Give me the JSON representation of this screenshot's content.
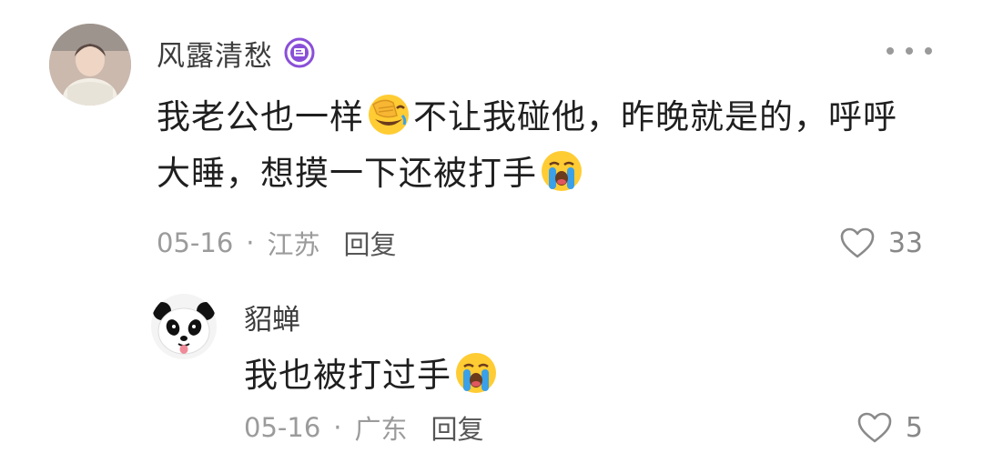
{
  "main_comment": {
    "username": "风露清愁",
    "text_parts": [
      "我老公也一样",
      "不让我碰他，昨晚就是的，呼呼大睡，想摸一下还被打手"
    ],
    "emojis": [
      "face-palm-laugh-emoji",
      "loudly-crying-face-emoji"
    ],
    "date": "05-16",
    "separator": "·",
    "location": "江苏",
    "reply_label": "回复",
    "like_count": "33"
  },
  "reply_comment": {
    "username": "貂蝉",
    "text": "我也被打过手",
    "emoji": "loudly-crying-face-emoji",
    "date": "05-16",
    "separator": "·",
    "location": "广东",
    "reply_label": "回复",
    "like_count": "5"
  },
  "colors": {
    "text_primary": "#1f1f1f",
    "text_secondary": "#9b9b9b",
    "username": "#3c3c3c",
    "badge": "#8a4fd8",
    "emoji_yellow": "#ffcc33",
    "tear_blue": "#3aa0e8"
  },
  "icons": {
    "more": "more-dots-icon",
    "like": "heart-outline-icon",
    "badge": "member-badge-icon"
  }
}
